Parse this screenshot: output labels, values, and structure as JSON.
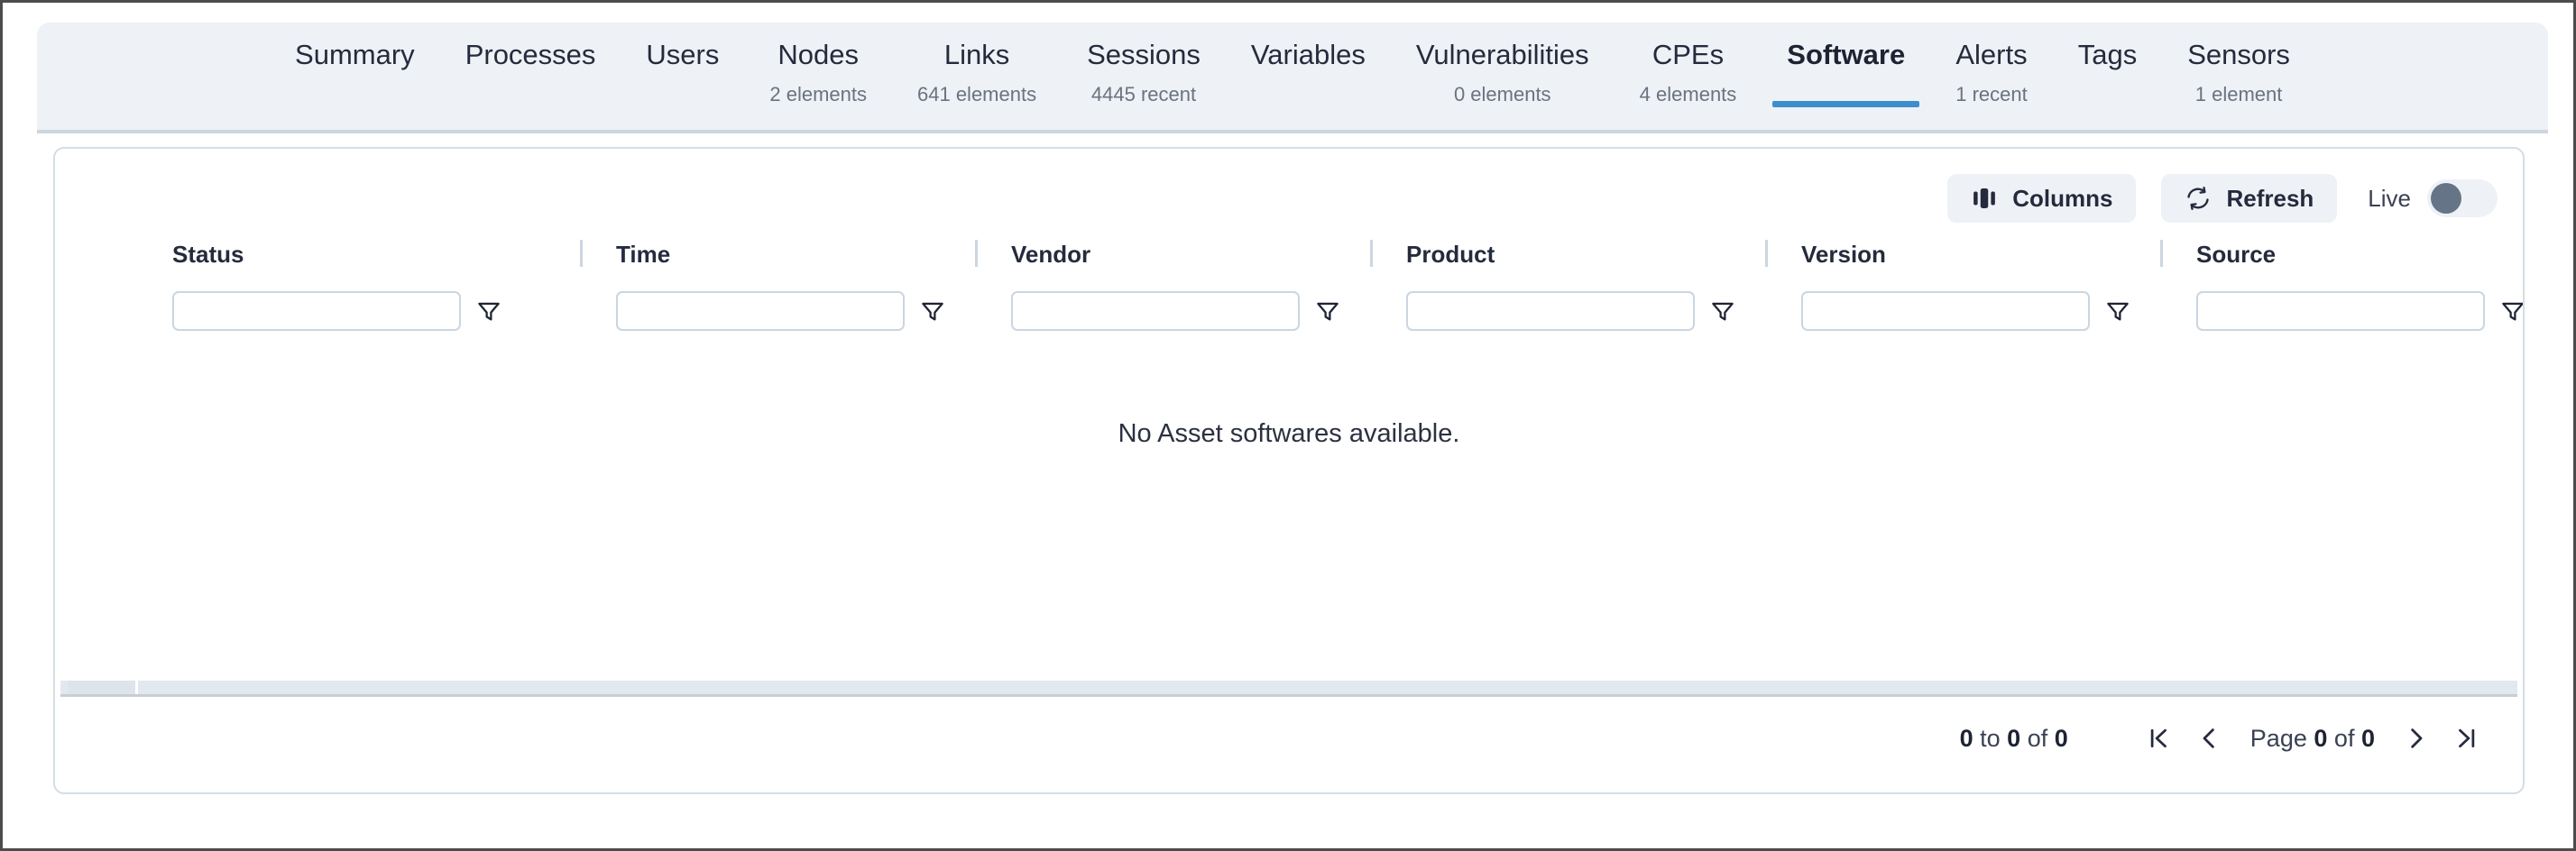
{
  "tabs": [
    {
      "label": "Summary",
      "sub": "",
      "active": false
    },
    {
      "label": "Processes",
      "sub": "",
      "active": false
    },
    {
      "label": "Users",
      "sub": "",
      "active": false
    },
    {
      "label": "Nodes",
      "sub": "2 elements",
      "active": false
    },
    {
      "label": "Links",
      "sub": "641 elements",
      "active": false
    },
    {
      "label": "Sessions",
      "sub": "4445 recent",
      "active": false
    },
    {
      "label": "Variables",
      "sub": "",
      "active": false
    },
    {
      "label": "Vulnerabilities",
      "sub": "0 elements",
      "active": false
    },
    {
      "label": "CPEs",
      "sub": "4 elements",
      "active": false
    },
    {
      "label": "Software",
      "sub": "",
      "active": true
    },
    {
      "label": "Alerts",
      "sub": "1 recent",
      "active": false
    },
    {
      "label": "Tags",
      "sub": "",
      "active": false
    },
    {
      "label": "Sensors",
      "sub": "1 element",
      "active": false
    }
  ],
  "toolbar": {
    "columns_label": "Columns",
    "refresh_label": "Refresh",
    "live_label": "Live",
    "live_on": false
  },
  "table": {
    "columns": [
      {
        "title": "Status",
        "filter_value": "",
        "filter_placeholder": ""
      },
      {
        "title": "Time",
        "filter_value": "",
        "filter_placeholder": ""
      },
      {
        "title": "Vendor",
        "filter_value": "",
        "filter_placeholder": ""
      },
      {
        "title": "Product",
        "filter_value": "",
        "filter_placeholder": ""
      },
      {
        "title": "Version",
        "filter_value": "",
        "filter_placeholder": ""
      },
      {
        "title": "Source",
        "filter_value": "",
        "filter_placeholder": ""
      }
    ],
    "rows": [],
    "empty_message": "No Asset softwares available."
  },
  "pagination": {
    "range_prefix": "0",
    "range_to": "to",
    "range_end": "0",
    "range_of": "of",
    "range_total": "0",
    "page_word": "Page",
    "page_current": "0",
    "page_of": "of",
    "page_total": "0"
  },
  "colors": {
    "accent": "#3d8fcc",
    "panel_bg": "#eef1f5",
    "card_bg": "#ffffff",
    "text": "#252b3d",
    "muted": "#6b7280",
    "border": "#d3dde5",
    "toggle_knob": "#667487"
  }
}
